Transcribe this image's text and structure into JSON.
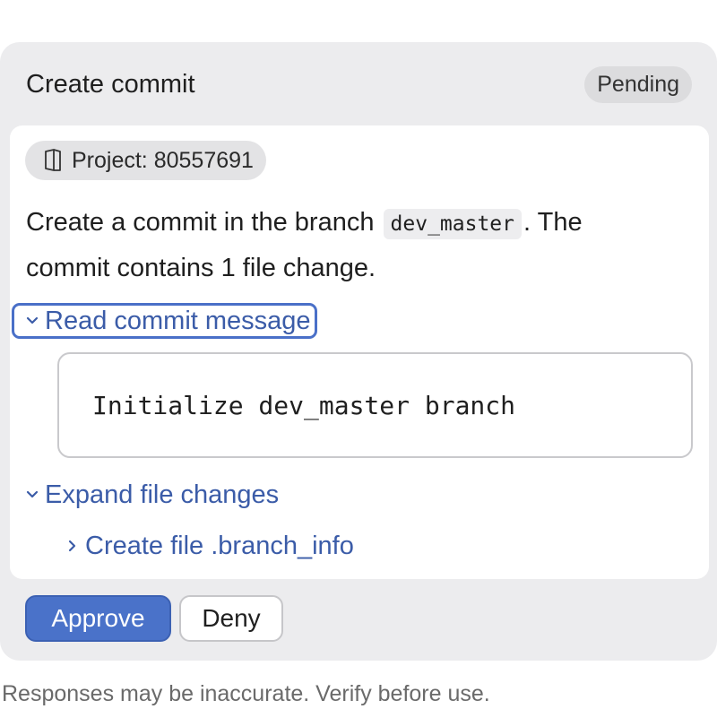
{
  "card": {
    "title": "Create commit",
    "status": "Pending"
  },
  "project_chip": {
    "icon": "book-icon",
    "label": "Project: 80557691"
  },
  "description": {
    "prefix": "Create a commit in the branch",
    "branch": "dev_master",
    "suffix_line1": ". The",
    "line2": "commit contains 1 file change."
  },
  "read_commit_message": {
    "label": "Read commit message",
    "icon": "chevron-down-icon"
  },
  "commit_message": "Initialize dev_master branch",
  "expand_file_changes": {
    "label": "Expand file changes",
    "icon": "chevron-down-icon"
  },
  "file_changes": [
    {
      "label": "Create file .branch_info",
      "icon": "chevron-right-icon"
    }
  ],
  "actions": {
    "approve_label": "Approve",
    "deny_label": "Deny"
  },
  "footer_note": "Responses may be inaccurate. Verify before use.",
  "colors": {
    "accent": "#4a72c9",
    "link": "#3b5ca8",
    "card_bg": "#ececee"
  }
}
